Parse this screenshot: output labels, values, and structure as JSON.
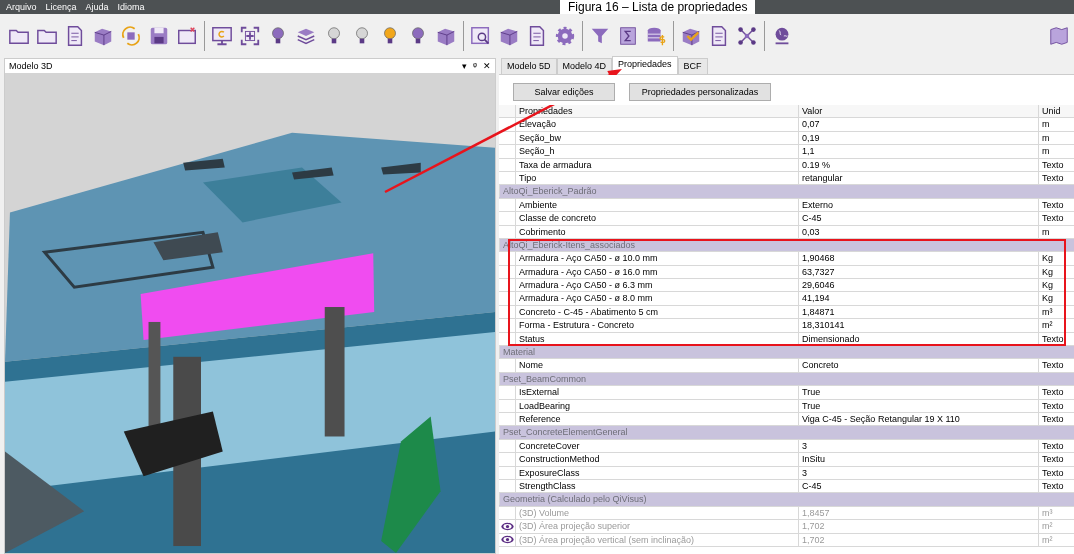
{
  "caption": "Figura 16 – Lista de propriedades",
  "menu": [
    "Arquivo",
    "Licença",
    "Ajuda",
    "Idioma"
  ],
  "left_panel": {
    "title": "Modelo 3D",
    "controls": [
      "▾",
      "ᵠ",
      "✕"
    ]
  },
  "tabs": [
    {
      "label": "Modelo 5D",
      "selected": false
    },
    {
      "label": "Modelo 4D",
      "selected": false
    },
    {
      "label": "Propriedades",
      "selected": true
    },
    {
      "label": "BCF",
      "selected": false
    }
  ],
  "buttons": [
    "Salvar edições",
    "Propriedades personalizadas"
  ],
  "table": {
    "columns": [
      "Propriedades",
      "Valor",
      "Unid"
    ],
    "sections": [
      {
        "highlighted": false,
        "rows": [
          {
            "name": "Elevação",
            "value": "0,07",
            "unit": "m",
            "disabled": false,
            "eye": false
          },
          {
            "name": "Seção_bw",
            "value": "0,19",
            "unit": "m",
            "disabled": false,
            "eye": false
          },
          {
            "name": "Seção_h",
            "value": "1,1",
            "unit": "m",
            "disabled": false,
            "eye": false
          },
          {
            "name": "Taxa de armadura",
            "value": "0.19 %",
            "unit": "Texto",
            "disabled": false,
            "eye": false
          },
          {
            "name": "Tipo",
            "value": "retangular",
            "unit": "Texto",
            "disabled": false,
            "eye": false
          }
        ]
      },
      {
        "title": "AltoQi_Eberick_Padrão",
        "highlighted": false,
        "rows": [
          {
            "name": "Ambiente",
            "value": "Externo",
            "unit": "Texto",
            "disabled": false,
            "eye": false
          },
          {
            "name": "Classe de concreto",
            "value": "C-45",
            "unit": "Texto",
            "disabled": false,
            "eye": false
          },
          {
            "name": "Cobrimento",
            "value": "0,03",
            "unit": "m",
            "disabled": false,
            "eye": false
          }
        ]
      },
      {
        "title": "AltoQi_Eberick-Itens_associados",
        "highlighted": true,
        "rows": [
          {
            "name": "Armadura - Aço CA50 - ø 10.0 mm",
            "value": "1,90468",
            "unit": "Kg",
            "disabled": false,
            "eye": false
          },
          {
            "name": "Armadura - Aço CA50 - ø 16.0 mm",
            "value": "63,7327",
            "unit": "Kg",
            "disabled": false,
            "eye": false
          },
          {
            "name": "Armadura - Aço CA50 - ø 6.3 mm",
            "value": "29,6046",
            "unit": "Kg",
            "disabled": false,
            "eye": false
          },
          {
            "name": "Armadura - Aço CA50 - ø 8.0 mm",
            "value": "41,194",
            "unit": "Kg",
            "disabled": false,
            "eye": false
          },
          {
            "name": "Concreto - C-45 - Abatimento 5 cm",
            "value": "1,84871",
            "unit": "m³",
            "disabled": false,
            "eye": false
          },
          {
            "name": "Forma - Estrutura - Concreto",
            "value": "18,310141",
            "unit": "m²",
            "disabled": false,
            "eye": false
          },
          {
            "name": "Status",
            "value": "Dimensionado",
            "unit": "Texto",
            "disabled": false,
            "eye": false
          }
        ]
      },
      {
        "title": "Material",
        "highlighted": false,
        "rows": [
          {
            "name": "Nome",
            "value": "Concreto",
            "unit": "Texto",
            "disabled": false,
            "eye": false
          }
        ]
      },
      {
        "title": "Pset_BeamCommon",
        "highlighted": false,
        "rows": [
          {
            "name": "IsExternal",
            "value": "True",
            "unit": "Texto",
            "disabled": false,
            "eye": false
          },
          {
            "name": "LoadBearing",
            "value": "True",
            "unit": "Texto",
            "disabled": false,
            "eye": false
          },
          {
            "name": "Reference",
            "value": "Viga C-45 - Seção Retangular 19 X 110",
            "unit": "Texto",
            "disabled": false,
            "eye": false
          }
        ]
      },
      {
        "title": "Pset_ConcreteElementGeneral",
        "highlighted": false,
        "rows": [
          {
            "name": "ConcreteCover",
            "value": "3",
            "unit": "Texto",
            "disabled": false,
            "eye": false
          },
          {
            "name": "ConstructionMethod",
            "value": "InSitu",
            "unit": "Texto",
            "disabled": false,
            "eye": false
          },
          {
            "name": "ExposureClass",
            "value": "3",
            "unit": "Texto",
            "disabled": false,
            "eye": false
          },
          {
            "name": "StrengthClass",
            "value": "C-45",
            "unit": "Texto",
            "disabled": false,
            "eye": false
          }
        ]
      },
      {
        "title": "Geometria (Calculado pelo QiVisus)",
        "highlighted": false,
        "rows": [
          {
            "name": "(3D) Volume",
            "value": "1,8457",
            "unit": "m³",
            "disabled": true,
            "eye": false
          },
          {
            "name": "(3D) Área projeção superior",
            "value": "1,702",
            "unit": "m²",
            "disabled": true,
            "eye": true
          },
          {
            "name": "(3D) Área projeção vertical (sem inclinação)",
            "value": "1,702",
            "unit": "m²",
            "disabled": true,
            "eye": true
          }
        ]
      }
    ]
  }
}
